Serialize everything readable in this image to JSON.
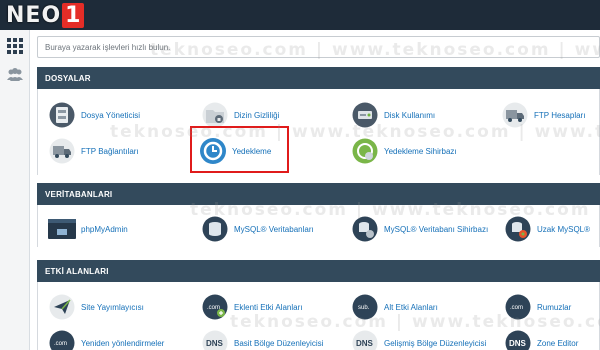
{
  "logo": {
    "part1": "NEO",
    "part2": "1"
  },
  "search": {
    "placeholder": "Buraya yazarak işlevleri hızlı bulun."
  },
  "sections": {
    "files": {
      "title": "DOSYALAR",
      "items": [
        {
          "label": "Dosya Yöneticisi",
          "icon": "file-cabinet-icon"
        },
        {
          "label": "Dizin Gizliliği",
          "icon": "folder-icon"
        },
        {
          "label": "Disk Kullanımı",
          "icon": "disk-usage-icon"
        },
        {
          "label": "FTP Hesapları",
          "icon": "ftp-truck-icon"
        },
        {
          "label": "FTP Bağlantıları",
          "icon": "ftp-truck-icon"
        },
        {
          "label": "Yedekleme",
          "icon": "backup-clock-icon"
        },
        {
          "label": "Yedekleme Sihirbazı",
          "icon": "backup-wizard-icon"
        }
      ]
    },
    "databases": {
      "title": "VERİTABANLARI",
      "items": [
        {
          "label": "phpMyAdmin",
          "icon": "phpmyadmin-icon"
        },
        {
          "label": "MySQL® Veritabanları",
          "icon": "database-icon"
        },
        {
          "label": "MySQL® Veritabanı Sihirbazı",
          "icon": "database-wizard-icon"
        },
        {
          "label": "Uzak MySQL®",
          "icon": "remote-database-icon"
        }
      ]
    },
    "domains": {
      "title": "ETKİ ALANLARI",
      "items": [
        {
          "label": "Site Yayımlayıcısı",
          "icon": "paper-plane-icon"
        },
        {
          "label": "Eklenti Etki Alanları",
          "icon": "addon-domain-icon"
        },
        {
          "label": "Alt Etki Alanları",
          "icon": "subdomain-icon"
        },
        {
          "label": "Rumuzlar",
          "icon": "alias-icon"
        },
        {
          "label": "Yeniden yönlendirmeler",
          "icon": "redirect-icon"
        },
        {
          "label": "Basit Bölge Düzenleyicisi",
          "icon": "dns-icon"
        },
        {
          "label": "Gelişmiş Bölge Düzenleyicisi",
          "icon": "dns-icon"
        },
        {
          "label": "Zone Editor",
          "icon": "dns-icon"
        }
      ]
    }
  },
  "watermark": "teknoseo.com | www.teknoseo.com | www.teknoseo.com",
  "colors": {
    "topbar": "#1e2b39",
    "section_header": "#334a5c",
    "link": "#1570b8",
    "highlight": "#e01b1b"
  }
}
